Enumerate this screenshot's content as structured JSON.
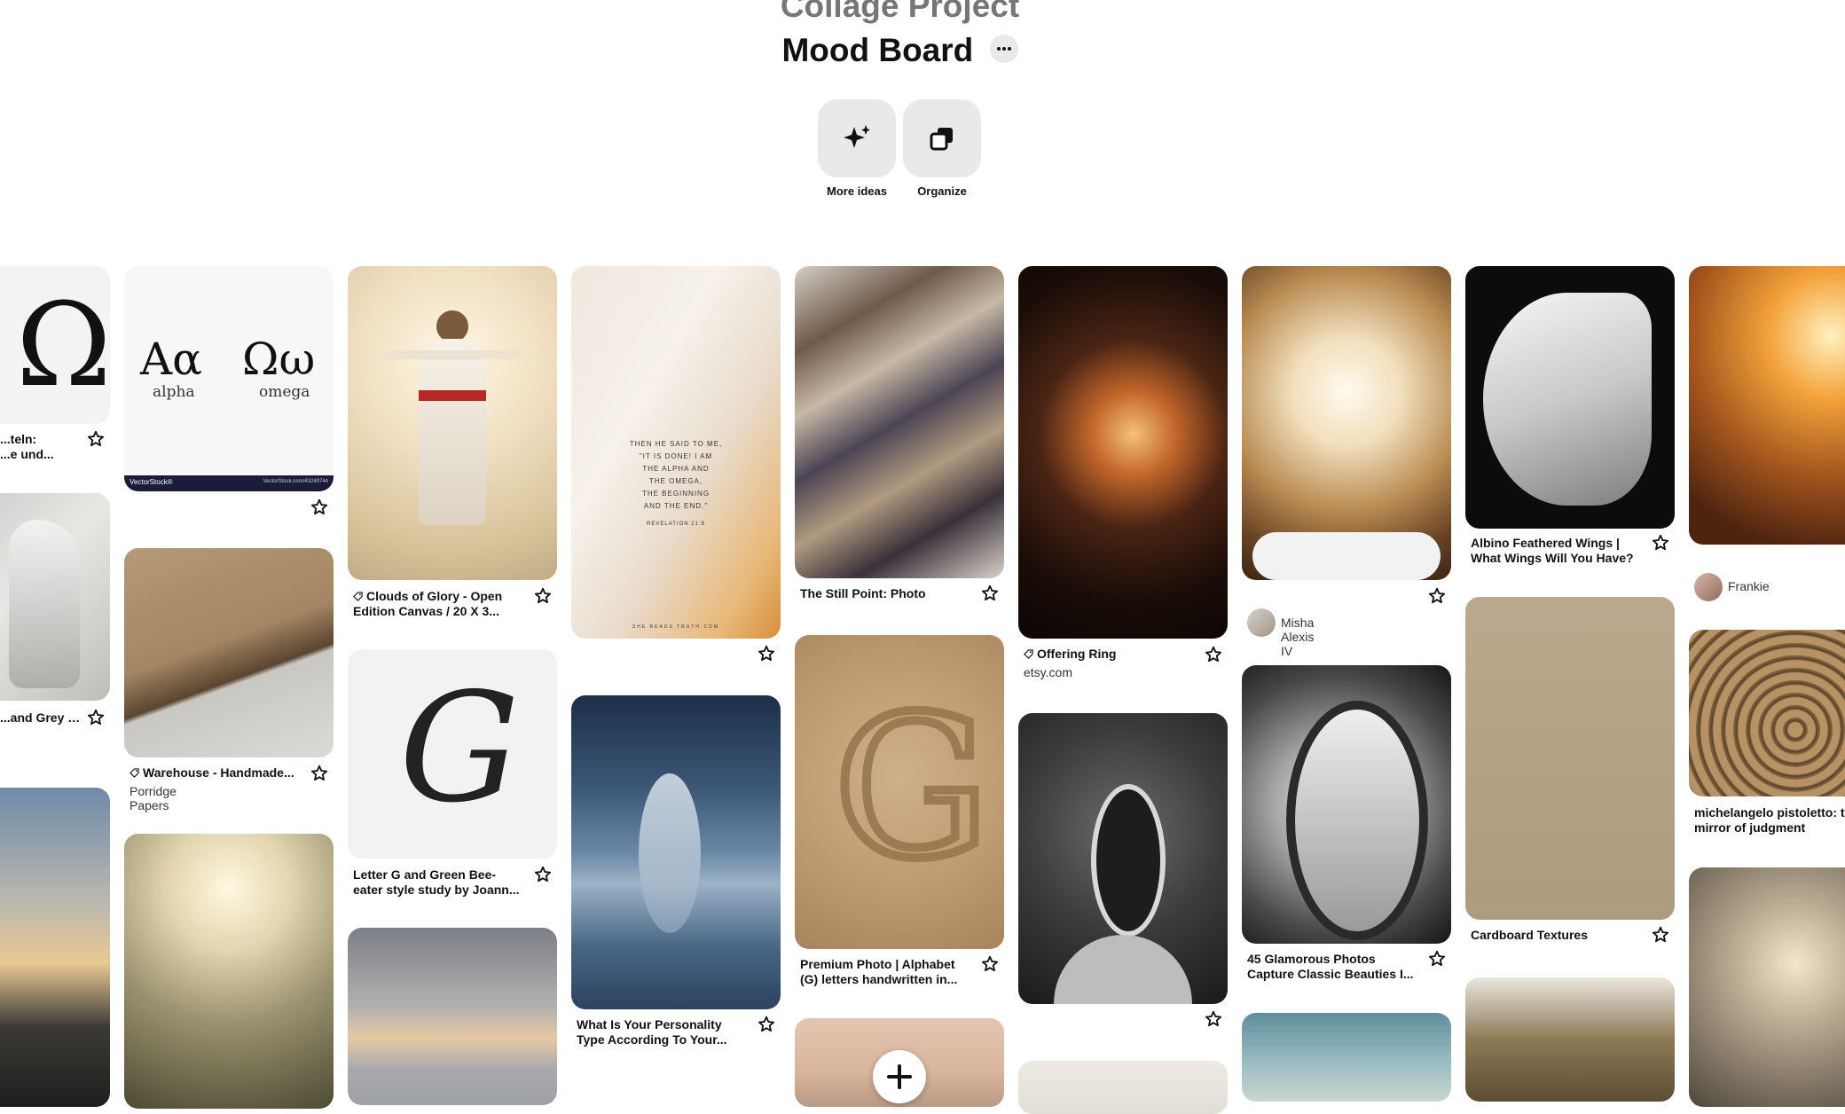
{
  "header": {
    "parent_title": "Collage Project",
    "board_title": "Mood Board",
    "more_ideas_label": "More ideas",
    "organize_label": "Organize"
  },
  "pins": {
    "omega_caption_1": "...teln:",
    "omega_caption_2": "...e und...",
    "alpha_omega_chart": {
      "alpha_letters": "Aα",
      "alpha_word": "alpha",
      "omega_letters": "Ωω",
      "omega_word": "omega",
      "omega_big": "Ω",
      "footer_left": "VectorStock®",
      "footer_right": "VectorStock.com/43249744"
    },
    "wings_caption": "...and Grey W...",
    "clouds_glory_1": "Clouds of Glory - Open",
    "clouds_glory_2": "Edition Canvas / 20 X 3...",
    "scripture": {
      "line1": "THEN HE SAID TO ME,",
      "line2": "\"IT IS DONE! I AM",
      "line3": "THE ALPHA AND",
      "line4": "THE OMEGA,",
      "line5": "THE BEGINNING",
      "line6": "AND THE END.\"",
      "reference": "REVELATION 21:6",
      "footer": "SHE READS TRUTH.COM"
    },
    "still_point": "The Still Point: Photo",
    "offering_ring": "Offering Ring",
    "offering_ring_source": "etsy.com",
    "misha_name": "Misha Alexis IV",
    "albino_wings_1": "Albino Feathered Wings |",
    "albino_wings_2": "What Wings Will You Have?",
    "frankie_name": "Frankie",
    "warehouse_1": "Warehouse - Handmade...",
    "warehouse_source": "Porridge Papers",
    "letter_g_1": "Letter G and Green Bee-",
    "letter_g_2": "eater style study by Joann...",
    "personality_1": "What Is Your Personality",
    "personality_2": "Type According To Your...",
    "premium_photo_1": "Premium Photo | Alphabet",
    "premium_photo_2": "(G) letters handwritten in...",
    "glamorous_1": "45 Glamorous Photos",
    "glamorous_2": "Capture Classic Beauties I...",
    "cardboard": "Cardboard Textures",
    "michelangelo_1": "michelangelo pistoletto: t",
    "michelangelo_2": "mirror of judgment",
    "script_g": "G"
  },
  "colors": {
    "button_bg": "#e9e9e9",
    "text": "#111111",
    "muted": "#767676"
  }
}
